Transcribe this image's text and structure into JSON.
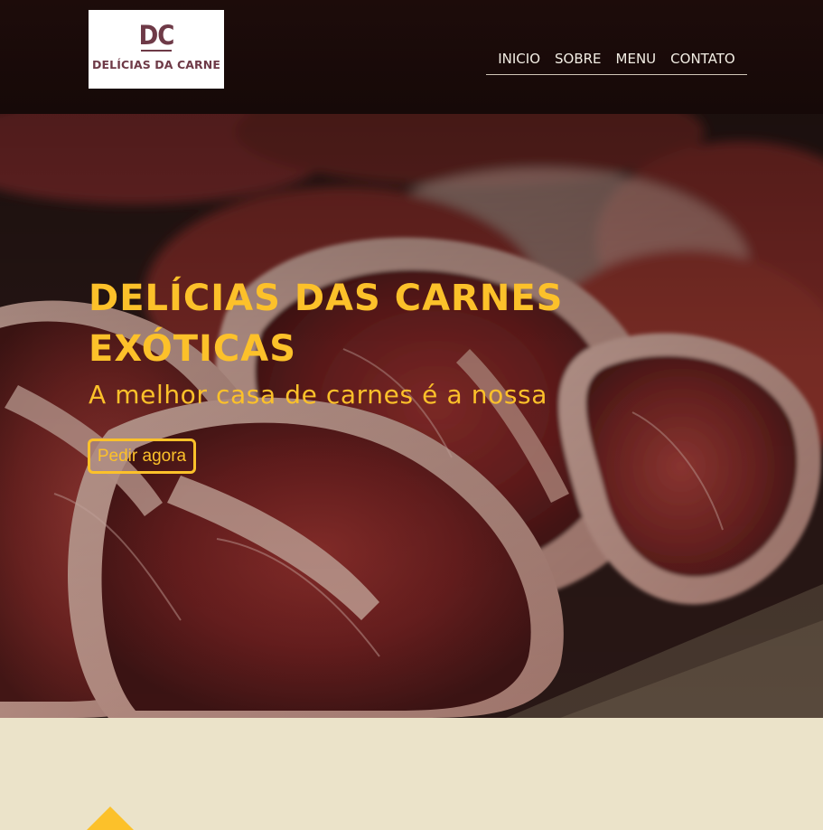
{
  "brand": {
    "monogram": "DC",
    "name": "DELÍCIAS DA CARNE"
  },
  "nav": {
    "items": [
      {
        "label": "INICIO"
      },
      {
        "label": "SOBRE"
      },
      {
        "label": "MENU"
      },
      {
        "label": "CONTATO"
      }
    ]
  },
  "hero": {
    "title": "DELÍCIAS DAS CARNES EXÓTICAS",
    "subtitle": "A melhor casa de carnes é a nossa",
    "cta_label": "Pedir agora"
  },
  "colors": {
    "header_bg": "#1d0c0a",
    "accent": "#fcc12a",
    "logo": "#6e3a47",
    "section_bg": "#ebe3c9"
  }
}
